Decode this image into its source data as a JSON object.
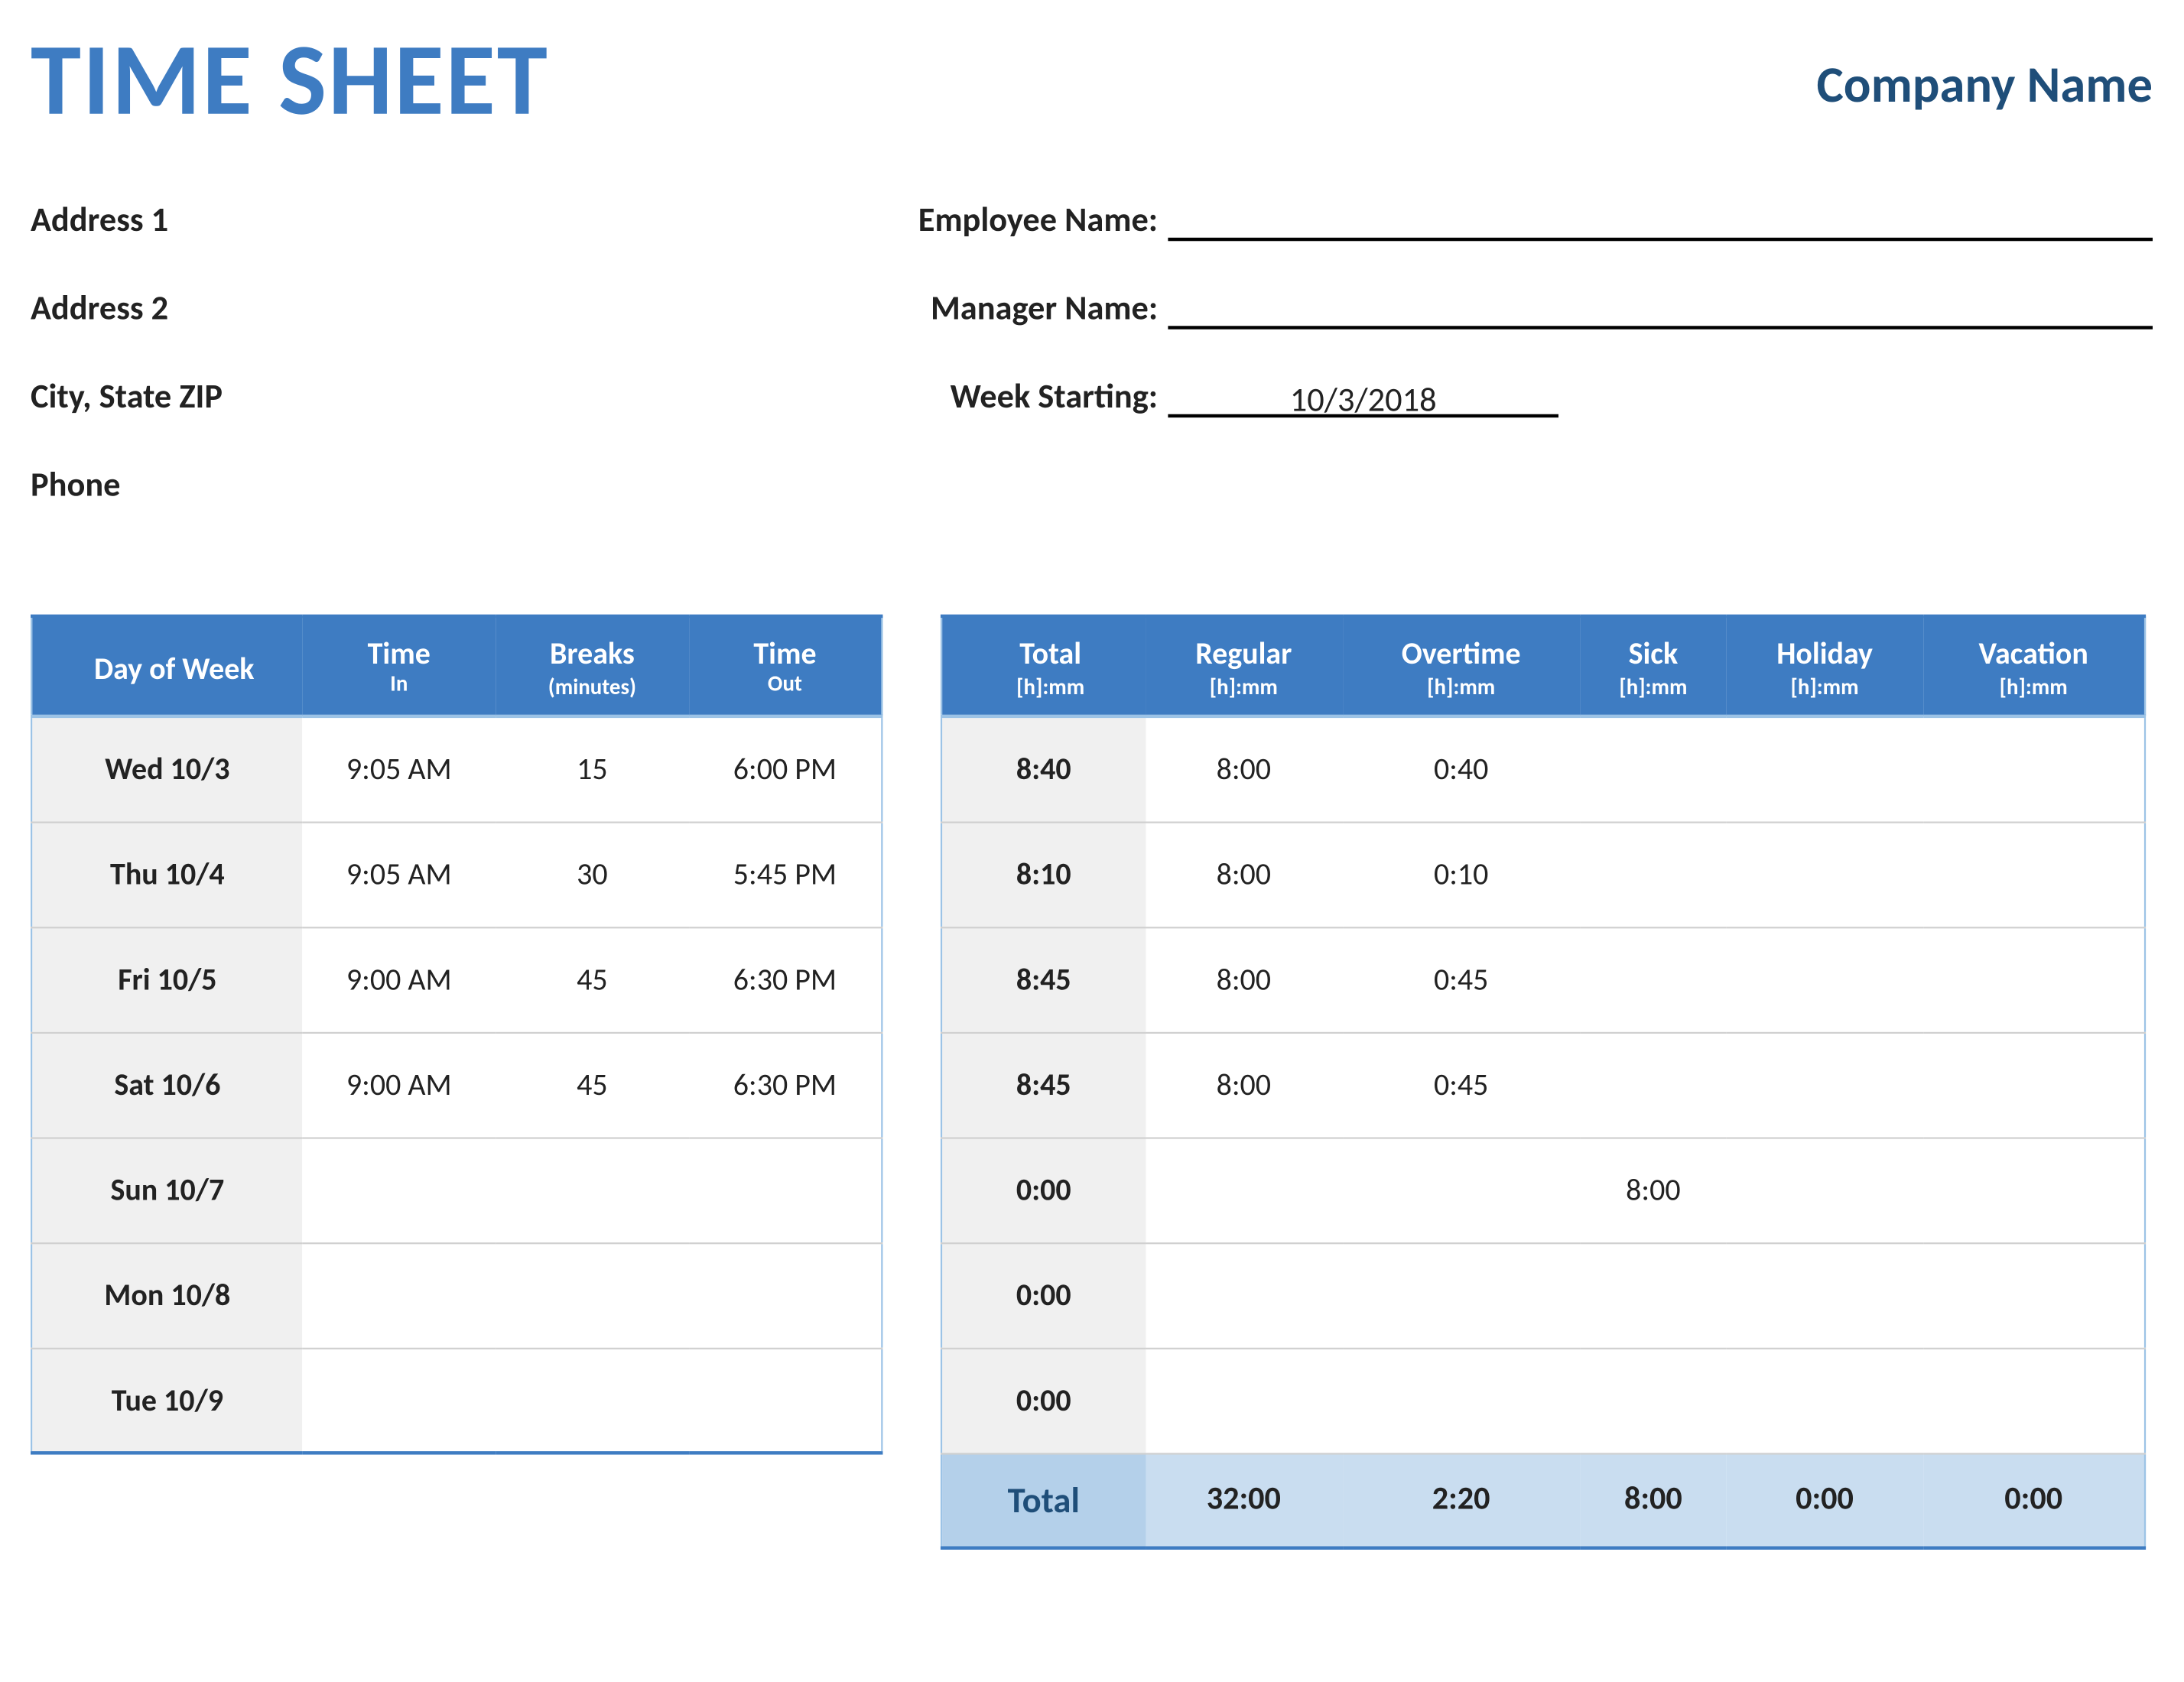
{
  "header": {
    "title": "TIME SHEET",
    "company": "Company Name"
  },
  "info": {
    "address1": "Address 1",
    "address2": "Address 2",
    "city_state_zip": "City, State  ZIP",
    "phone": "Phone",
    "employee_label": "Employee Name:",
    "manager_label": "Manager Name:",
    "week_starting_label": "Week Starting:",
    "week_starting_value": "10/3/2018"
  },
  "left_table": {
    "headers": {
      "day": "Day of Week",
      "time_in": "Time",
      "time_in_sub": "In",
      "breaks": "Breaks",
      "breaks_sub": "(minutes)",
      "time_out": "Time",
      "time_out_sub": "Out"
    },
    "rows": [
      {
        "day": "Wed 10/3",
        "in": "9:05 AM",
        "breaks": "15",
        "out": "6:00 PM"
      },
      {
        "day": "Thu 10/4",
        "in": "9:05 AM",
        "breaks": "30",
        "out": "5:45 PM"
      },
      {
        "day": "Fri 10/5",
        "in": "9:00 AM",
        "breaks": "45",
        "out": "6:30 PM"
      },
      {
        "day": "Sat 10/6",
        "in": "9:00 AM",
        "breaks": "45",
        "out": "6:30 PM"
      },
      {
        "day": "Sun 10/7",
        "in": "",
        "breaks": "",
        "out": ""
      },
      {
        "day": "Mon 10/8",
        "in": "",
        "breaks": "",
        "out": ""
      },
      {
        "day": "Tue 10/9",
        "in": "",
        "breaks": "",
        "out": ""
      }
    ]
  },
  "right_table": {
    "headers": {
      "total": "Total",
      "regular": "Regular",
      "overtime": "Overtime",
      "sick": "Sick",
      "holiday": "Holiday",
      "vacation": "Vacation",
      "sub": "[h]:mm"
    },
    "rows": [
      {
        "total": "8:40",
        "regular": "8:00",
        "overtime": "0:40",
        "sick": "",
        "holiday": "",
        "vacation": ""
      },
      {
        "total": "8:10",
        "regular": "8:00",
        "overtime": "0:10",
        "sick": "",
        "holiday": "",
        "vacation": ""
      },
      {
        "total": "8:45",
        "regular": "8:00",
        "overtime": "0:45",
        "sick": "",
        "holiday": "",
        "vacation": ""
      },
      {
        "total": "8:45",
        "regular": "8:00",
        "overtime": "0:45",
        "sick": "",
        "holiday": "",
        "vacation": ""
      },
      {
        "total": "0:00",
        "regular": "",
        "overtime": "",
        "sick": "8:00",
        "holiday": "",
        "vacation": ""
      },
      {
        "total": "0:00",
        "regular": "",
        "overtime": "",
        "sick": "",
        "holiday": "",
        "vacation": ""
      },
      {
        "total": "0:00",
        "regular": "",
        "overtime": "",
        "sick": "",
        "holiday": "",
        "vacation": ""
      }
    ],
    "footer": {
      "label": "Total",
      "regular": "32:00",
      "overtime": "2:20",
      "sick": "8:00",
      "holiday": "0:00",
      "vacation": "0:00"
    }
  }
}
